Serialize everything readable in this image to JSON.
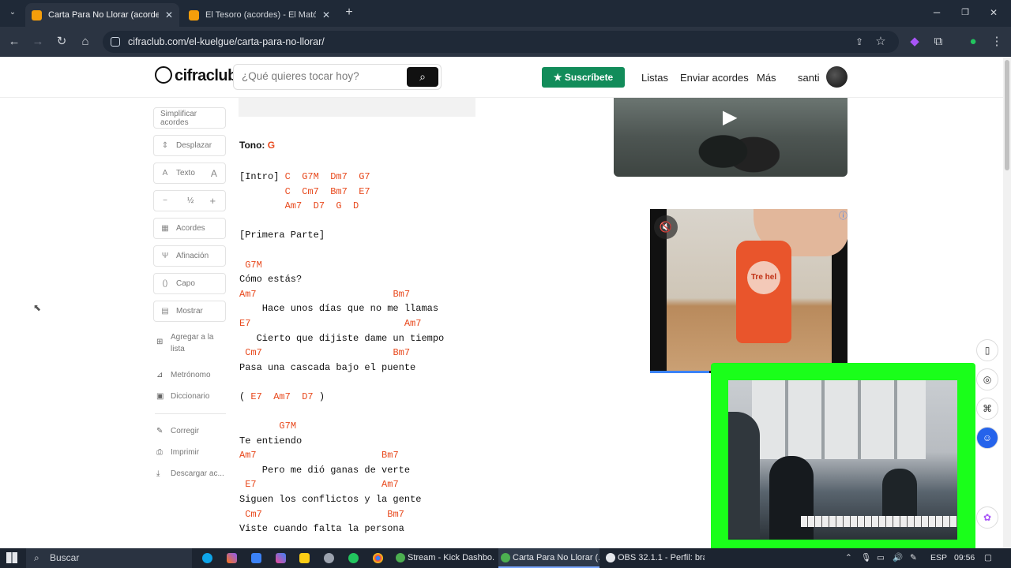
{
  "browser": {
    "tabs": [
      {
        "title": "Carta Para No Llorar (acordes)",
        "active": true
      },
      {
        "title": "El Tesoro (acordes) - El Mató a u",
        "active": false
      }
    ],
    "url": "cifraclub.com/el-kuelgue/carta-para-no-llorar/"
  },
  "site": {
    "logo": "cifraclub",
    "search_placeholder": "¿Qué quieres tocar hoy?",
    "subscribe_label": "Suscríbete",
    "nav": {
      "lists": "Listas",
      "send_chords": "Enviar acordes",
      "more": "Más"
    },
    "username": "santi"
  },
  "sidebar": {
    "simplify": "Simplificar acordes",
    "scroll": "Desplazar",
    "text": "Texto",
    "half": "½",
    "chords": "Acordes",
    "tuning": "Afinación",
    "capo": "Capo",
    "show": "Mostrar",
    "add_to_list": "Agregar a la lista",
    "metronome": "Metrónomo",
    "dictionary": "Diccionario",
    "correct": "Corregir",
    "print": "Imprimir",
    "download": "Descargar ac..."
  },
  "song": {
    "key_label": "Tono:",
    "key": "G",
    "lines": [
      [
        {
          "t": "[Intro] "
        },
        {
          "t": "C  G7M  Dm7  G7",
          "c": 1
        }
      ],
      [
        {
          "t": "        "
        },
        {
          "t": "C  Cm7  Bm7  E7",
          "c": 1
        }
      ],
      [
        {
          "t": "        "
        },
        {
          "t": "Am7  D7  G  D",
          "c": 1
        }
      ],
      [
        {
          "t": ""
        }
      ],
      [
        {
          "t": "[Primera Parte]"
        }
      ],
      [
        {
          "t": ""
        }
      ],
      [
        {
          "t": " "
        },
        {
          "t": "G7M",
          "c": 1
        }
      ],
      [
        {
          "t": "Cómo estás?"
        }
      ],
      [
        {
          "t": "Am7",
          "c": 1
        },
        {
          "t": "                        "
        },
        {
          "t": "Bm7",
          "c": 1
        }
      ],
      [
        {
          "t": "    Hace unos días que no me llamas"
        }
      ],
      [
        {
          "t": "E7",
          "c": 1
        },
        {
          "t": "                           "
        },
        {
          "t": "Am7",
          "c": 1
        }
      ],
      [
        {
          "t": "   Cierto que dijiste dame un tiempo"
        }
      ],
      [
        {
          "t": " "
        },
        {
          "t": "Cm7",
          "c": 1
        },
        {
          "t": "                       "
        },
        {
          "t": "Bm7",
          "c": 1
        }
      ],
      [
        {
          "t": "Pasa una cascada bajo el puente"
        }
      ],
      [
        {
          "t": ""
        }
      ],
      [
        {
          "t": "( "
        },
        {
          "t": "E7",
          "c": 1
        },
        {
          "t": "  "
        },
        {
          "t": "Am7",
          "c": 1
        },
        {
          "t": "  "
        },
        {
          "t": "D7",
          "c": 1
        },
        {
          "t": " )"
        }
      ],
      [
        {
          "t": ""
        }
      ],
      [
        {
          "t": "       "
        },
        {
          "t": "G7M",
          "c": 1
        }
      ],
      [
        {
          "t": "Te entiendo"
        }
      ],
      [
        {
          "t": "Am7",
          "c": 1
        },
        {
          "t": "                      "
        },
        {
          "t": "Bm7",
          "c": 1
        }
      ],
      [
        {
          "t": "    Pero me dió ganas de verte"
        }
      ],
      [
        {
          "t": " "
        },
        {
          "t": "E7",
          "c": 1
        },
        {
          "t": "                      "
        },
        {
          "t": "Am7",
          "c": 1
        }
      ],
      [
        {
          "t": "Siguen los conflictos y la gente"
        }
      ],
      [
        {
          "t": " "
        },
        {
          "t": "Cm7",
          "c": 1
        },
        {
          "t": "                      "
        },
        {
          "t": "Bm7",
          "c": 1
        }
      ],
      [
        {
          "t": "Viste cuando falta la persona"
        }
      ]
    ]
  },
  "ads": {
    "bottle_label": "Tre hel"
  },
  "taskbar": {
    "search": "Buscar",
    "apps": [
      {
        "label": "Stream - Kick Dashbo...",
        "active": false
      },
      {
        "label": "Carta Para No Llorar (...",
        "active": true
      },
      {
        "label": "OBS 32.1.1 - Perfil: bra...",
        "active": false
      }
    ],
    "lang": "ESP",
    "time": "09:56"
  },
  "colors": {
    "accent_chord": "#e8491d",
    "subscribe": "#128c5a",
    "webcam_border": "#1aff1a"
  }
}
